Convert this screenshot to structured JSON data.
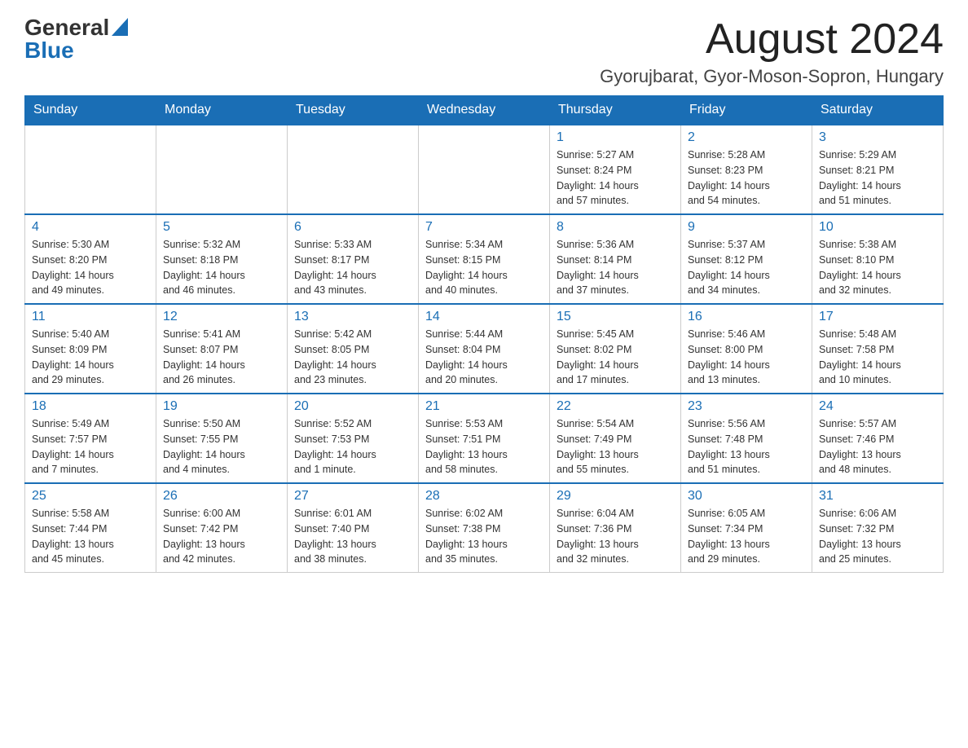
{
  "header": {
    "logo": {
      "general": "General",
      "triangle": "▲",
      "blue": "Blue"
    },
    "title": "August 2024",
    "location": "Gyorujbarat, Gyor-Moson-Sopron, Hungary"
  },
  "days_of_week": [
    "Sunday",
    "Monday",
    "Tuesday",
    "Wednesday",
    "Thursday",
    "Friday",
    "Saturday"
  ],
  "weeks": [
    [
      {
        "day": "",
        "info": ""
      },
      {
        "day": "",
        "info": ""
      },
      {
        "day": "",
        "info": ""
      },
      {
        "day": "",
        "info": ""
      },
      {
        "day": "1",
        "info": "Sunrise: 5:27 AM\nSunset: 8:24 PM\nDaylight: 14 hours\nand 57 minutes."
      },
      {
        "day": "2",
        "info": "Sunrise: 5:28 AM\nSunset: 8:23 PM\nDaylight: 14 hours\nand 54 minutes."
      },
      {
        "day": "3",
        "info": "Sunrise: 5:29 AM\nSunset: 8:21 PM\nDaylight: 14 hours\nand 51 minutes."
      }
    ],
    [
      {
        "day": "4",
        "info": "Sunrise: 5:30 AM\nSunset: 8:20 PM\nDaylight: 14 hours\nand 49 minutes."
      },
      {
        "day": "5",
        "info": "Sunrise: 5:32 AM\nSunset: 8:18 PM\nDaylight: 14 hours\nand 46 minutes."
      },
      {
        "day": "6",
        "info": "Sunrise: 5:33 AM\nSunset: 8:17 PM\nDaylight: 14 hours\nand 43 minutes."
      },
      {
        "day": "7",
        "info": "Sunrise: 5:34 AM\nSunset: 8:15 PM\nDaylight: 14 hours\nand 40 minutes."
      },
      {
        "day": "8",
        "info": "Sunrise: 5:36 AM\nSunset: 8:14 PM\nDaylight: 14 hours\nand 37 minutes."
      },
      {
        "day": "9",
        "info": "Sunrise: 5:37 AM\nSunset: 8:12 PM\nDaylight: 14 hours\nand 34 minutes."
      },
      {
        "day": "10",
        "info": "Sunrise: 5:38 AM\nSunset: 8:10 PM\nDaylight: 14 hours\nand 32 minutes."
      }
    ],
    [
      {
        "day": "11",
        "info": "Sunrise: 5:40 AM\nSunset: 8:09 PM\nDaylight: 14 hours\nand 29 minutes."
      },
      {
        "day": "12",
        "info": "Sunrise: 5:41 AM\nSunset: 8:07 PM\nDaylight: 14 hours\nand 26 minutes."
      },
      {
        "day": "13",
        "info": "Sunrise: 5:42 AM\nSunset: 8:05 PM\nDaylight: 14 hours\nand 23 minutes."
      },
      {
        "day": "14",
        "info": "Sunrise: 5:44 AM\nSunset: 8:04 PM\nDaylight: 14 hours\nand 20 minutes."
      },
      {
        "day": "15",
        "info": "Sunrise: 5:45 AM\nSunset: 8:02 PM\nDaylight: 14 hours\nand 17 minutes."
      },
      {
        "day": "16",
        "info": "Sunrise: 5:46 AM\nSunset: 8:00 PM\nDaylight: 14 hours\nand 13 minutes."
      },
      {
        "day": "17",
        "info": "Sunrise: 5:48 AM\nSunset: 7:58 PM\nDaylight: 14 hours\nand 10 minutes."
      }
    ],
    [
      {
        "day": "18",
        "info": "Sunrise: 5:49 AM\nSunset: 7:57 PM\nDaylight: 14 hours\nand 7 minutes."
      },
      {
        "day": "19",
        "info": "Sunrise: 5:50 AM\nSunset: 7:55 PM\nDaylight: 14 hours\nand 4 minutes."
      },
      {
        "day": "20",
        "info": "Sunrise: 5:52 AM\nSunset: 7:53 PM\nDaylight: 14 hours\nand 1 minute."
      },
      {
        "day": "21",
        "info": "Sunrise: 5:53 AM\nSunset: 7:51 PM\nDaylight: 13 hours\nand 58 minutes."
      },
      {
        "day": "22",
        "info": "Sunrise: 5:54 AM\nSunset: 7:49 PM\nDaylight: 13 hours\nand 55 minutes."
      },
      {
        "day": "23",
        "info": "Sunrise: 5:56 AM\nSunset: 7:48 PM\nDaylight: 13 hours\nand 51 minutes."
      },
      {
        "day": "24",
        "info": "Sunrise: 5:57 AM\nSunset: 7:46 PM\nDaylight: 13 hours\nand 48 minutes."
      }
    ],
    [
      {
        "day": "25",
        "info": "Sunrise: 5:58 AM\nSunset: 7:44 PM\nDaylight: 13 hours\nand 45 minutes."
      },
      {
        "day": "26",
        "info": "Sunrise: 6:00 AM\nSunset: 7:42 PM\nDaylight: 13 hours\nand 42 minutes."
      },
      {
        "day": "27",
        "info": "Sunrise: 6:01 AM\nSunset: 7:40 PM\nDaylight: 13 hours\nand 38 minutes."
      },
      {
        "day": "28",
        "info": "Sunrise: 6:02 AM\nSunset: 7:38 PM\nDaylight: 13 hours\nand 35 minutes."
      },
      {
        "day": "29",
        "info": "Sunrise: 6:04 AM\nSunset: 7:36 PM\nDaylight: 13 hours\nand 32 minutes."
      },
      {
        "day": "30",
        "info": "Sunrise: 6:05 AM\nSunset: 7:34 PM\nDaylight: 13 hours\nand 29 minutes."
      },
      {
        "day": "31",
        "info": "Sunrise: 6:06 AM\nSunset: 7:32 PM\nDaylight: 13 hours\nand 25 minutes."
      }
    ]
  ]
}
